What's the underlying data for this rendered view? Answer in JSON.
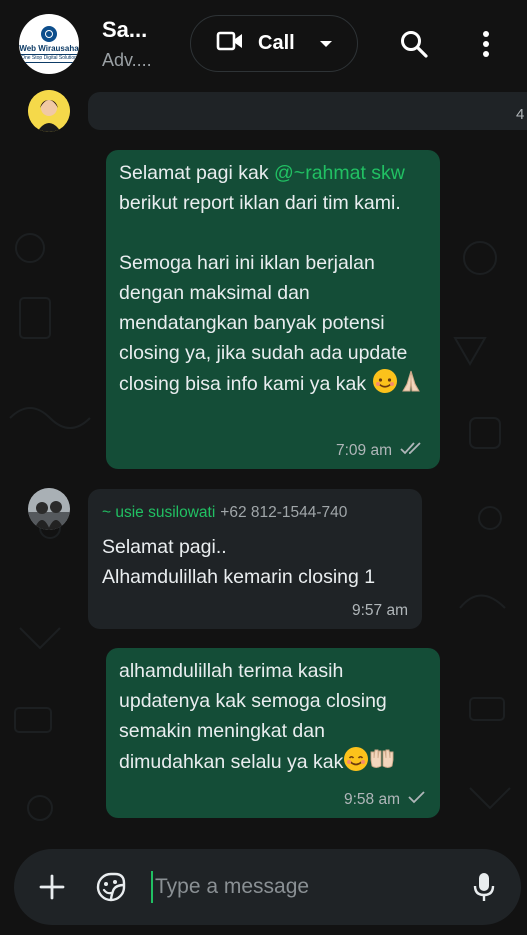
{
  "header": {
    "group_title": "Sa...",
    "group_subtitle": "Adv....",
    "avatar_logo_name": "Web Wirausaha",
    "avatar_logo_tagline": "One Stop Digital Solution",
    "call_label": "Call",
    "icons": [
      "video-camera-icon",
      "chevron-down-icon",
      "search-icon",
      "more-vertical-icon"
    ]
  },
  "chat": {
    "top_sliver_text": "4",
    "messages": [
      {
        "direction": "outgoing",
        "text_before": "Selamat pagi kak ",
        "mention": "@~rahmat skw",
        "text_after": " berikut report iklan dari tim kami.\n\nSemoga hari ini iklan berjalan dengan maksimal dan mendatangkan banyak potensi closing ya, jika sudah ada update closing bisa info kami ya kak ",
        "emojis": [
          "smiling-face-icon",
          "folded-hands-icon"
        ],
        "time": "7:09 am",
        "status": "double-check-icon"
      },
      {
        "direction": "incoming",
        "sender_name": "~ usie susilowati",
        "sender_phone": "+62 812-1544-740",
        "text": "Selamat pagi..\nAlhamdulillah kemarin closing 1",
        "time": "9:57 am"
      },
      {
        "direction": "outgoing",
        "text": "alhamdulillah terima kasih updatenya kak semoga closing semakin meningkat dan dimudahkan selalu ya kak",
        "emojis": [
          "smiling-face-icon",
          "palms-up-icon"
        ],
        "time": "9:58 am",
        "status": "single-check-icon"
      }
    ]
  },
  "input": {
    "placeholder": "Type a message",
    "icons": [
      "plus-icon",
      "sticker-icon",
      "microphone-icon"
    ]
  },
  "colors": {
    "background": "#121212",
    "outgoing_bubble": "#144d37",
    "incoming_bubble": "#1f2326",
    "accent": "#21c063",
    "text": "#e9edef"
  }
}
